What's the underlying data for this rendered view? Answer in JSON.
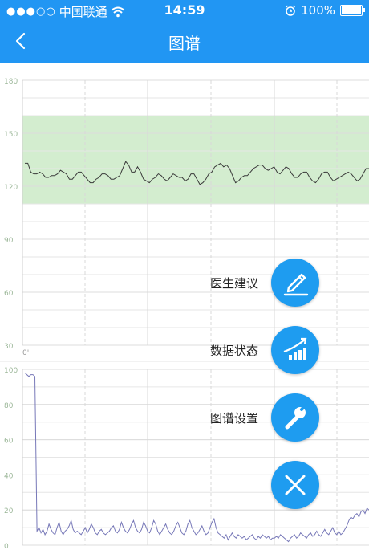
{
  "status_bar": {
    "carrier": "中国联通",
    "time": "14:59",
    "battery": "100%"
  },
  "nav": {
    "title": "图谱",
    "back_icon": "chevron-left-icon"
  },
  "colors": {
    "header": "#2196f3",
    "fab": "#1e9cf0",
    "fhr_band": "#d3edcf",
    "fhr_line": "#3a3a3a",
    "uc_line": "#7778b8",
    "grid": "#e6e6e6"
  },
  "menu": {
    "items": [
      {
        "label": "医生建议",
        "icon": "pencil-icon"
      },
      {
        "label": "数据状态",
        "icon": "chart-up-icon"
      },
      {
        "label": "图谱设置",
        "icon": "wrench-icon"
      }
    ],
    "close_icon": "close-icon"
  },
  "chart_data": [
    {
      "type": "line",
      "ylim": [
        30,
        180
      ],
      "yticks": [
        180,
        150,
        120,
        90,
        60,
        30
      ],
      "band": [
        110,
        160
      ],
      "x_label_start": "0'",
      "series": [
        {
          "values": [
            133,
            133,
            128,
            127,
            127,
            128,
            127,
            125,
            125,
            126,
            126,
            127,
            129,
            128,
            127,
            124,
            124,
            126,
            128,
            128,
            126,
            124,
            122,
            122,
            124,
            125,
            127,
            127,
            126,
            124,
            124,
            125,
            126,
            130,
            134,
            132,
            128,
            128,
            131,
            128,
            124,
            123,
            122,
            124,
            125,
            127,
            126,
            124,
            123,
            125,
            127,
            126,
            125,
            125,
            123,
            124,
            127,
            127,
            124,
            121,
            122,
            124,
            127,
            128,
            131,
            132,
            133,
            131,
            132,
            130,
            126,
            122,
            123,
            125,
            126,
            126,
            128,
            130,
            131,
            132,
            132,
            130,
            129,
            130,
            131,
            128,
            127,
            129,
            131,
            130,
            127,
            125,
            125,
            127,
            128,
            128,
            125,
            123,
            122,
            124,
            127,
            128,
            128,
            125,
            123,
            124,
            125,
            126,
            127,
            128,
            127,
            125,
            123,
            124,
            127,
            130,
            130
          ]
        }
      ]
    },
    {
      "type": "line",
      "ylim": [
        0,
        100
      ],
      "yticks": [
        100,
        80,
        60,
        40,
        20,
        0
      ],
      "series": [
        {
          "values": [
            98,
            97,
            96,
            97,
            97,
            96,
            8,
            10,
            7,
            9,
            6,
            8,
            12,
            9,
            7,
            6,
            10,
            13,
            8,
            6,
            8,
            9,
            11,
            14,
            9,
            7,
            8,
            7,
            6,
            8,
            10,
            7,
            9,
            12,
            10,
            7,
            6,
            8,
            9,
            7,
            6,
            7,
            8,
            10,
            11,
            8,
            7,
            9,
            13,
            10,
            8,
            7,
            9,
            12,
            14,
            10,
            8,
            7,
            9,
            13,
            11,
            8,
            7,
            10,
            14,
            12,
            8,
            6,
            8,
            10,
            12,
            9,
            7,
            6,
            8,
            11,
            13,
            10,
            7,
            6,
            8,
            12,
            14,
            10,
            8,
            6,
            7,
            9,
            11,
            8,
            6,
            7,
            10,
            13,
            15,
            10,
            7,
            6,
            5,
            4,
            6,
            3,
            5,
            7,
            5,
            4,
            6,
            5,
            4,
            5,
            3,
            4,
            5,
            6,
            4,
            3,
            5,
            4,
            6,
            5,
            4,
            5,
            3,
            4,
            4,
            5,
            4,
            6,
            5,
            4,
            3,
            2,
            4,
            5,
            6,
            4,
            5,
            7,
            6,
            5,
            4,
            6,
            7,
            5,
            6,
            8,
            6,
            5,
            7,
            9,
            7,
            6,
            8,
            10,
            7,
            6,
            8,
            6,
            7,
            9,
            11,
            14,
            16,
            15,
            17,
            18,
            16,
            19,
            20,
            18,
            21,
            20
          ]
        }
      ]
    }
  ]
}
